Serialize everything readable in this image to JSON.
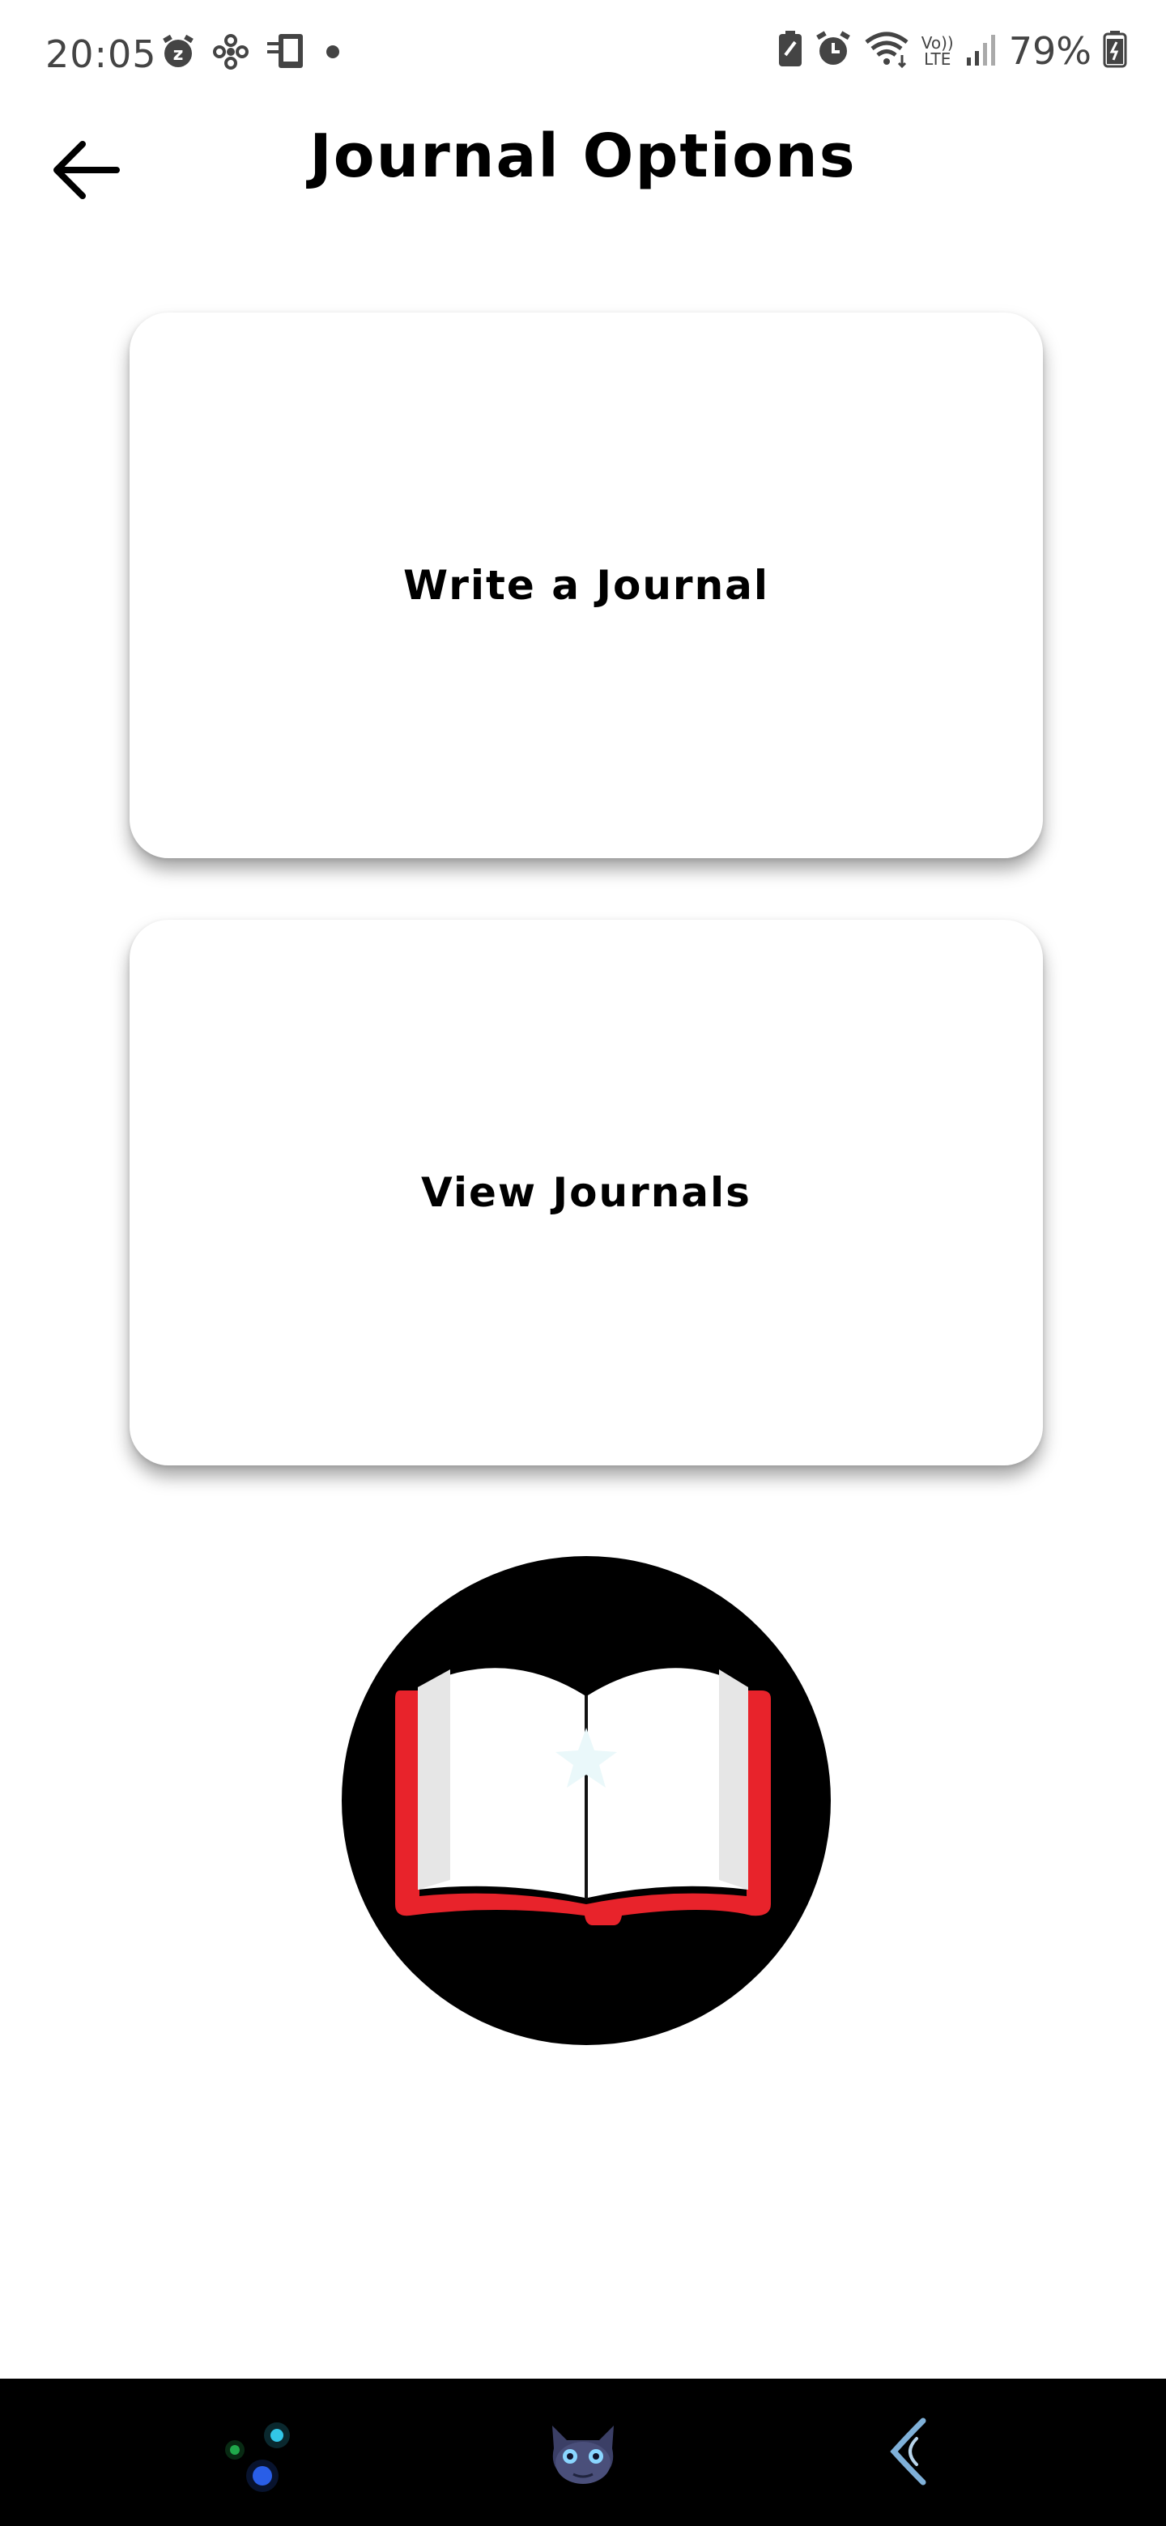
{
  "status_bar": {
    "time": "20:05",
    "battery_percent": "79%",
    "icons": [
      "alarm-snooze-icon",
      "fan-icon",
      "device-icon",
      "notification-dot-icon",
      "battery-saver-icon",
      "alarm-icon",
      "wifi-icon",
      "volte-icon",
      "signal-icon",
      "battery-icon"
    ],
    "volte_top": "Vo))",
    "volte_bottom": "LTE"
  },
  "header": {
    "title": "Journal Options",
    "back_icon": "arrow-left-icon"
  },
  "options": [
    {
      "label": "Write a Journal"
    },
    {
      "label": "View Journals"
    }
  ],
  "illustration": {
    "icon": "open-book-icon",
    "colors": {
      "circle": "#000000",
      "cover": "#e8232b",
      "pages": "#ffffff"
    }
  },
  "nav_bar": {
    "items": [
      "app-dots-icon",
      "dragon-avatar-icon",
      "back-gesture-icon"
    ]
  }
}
